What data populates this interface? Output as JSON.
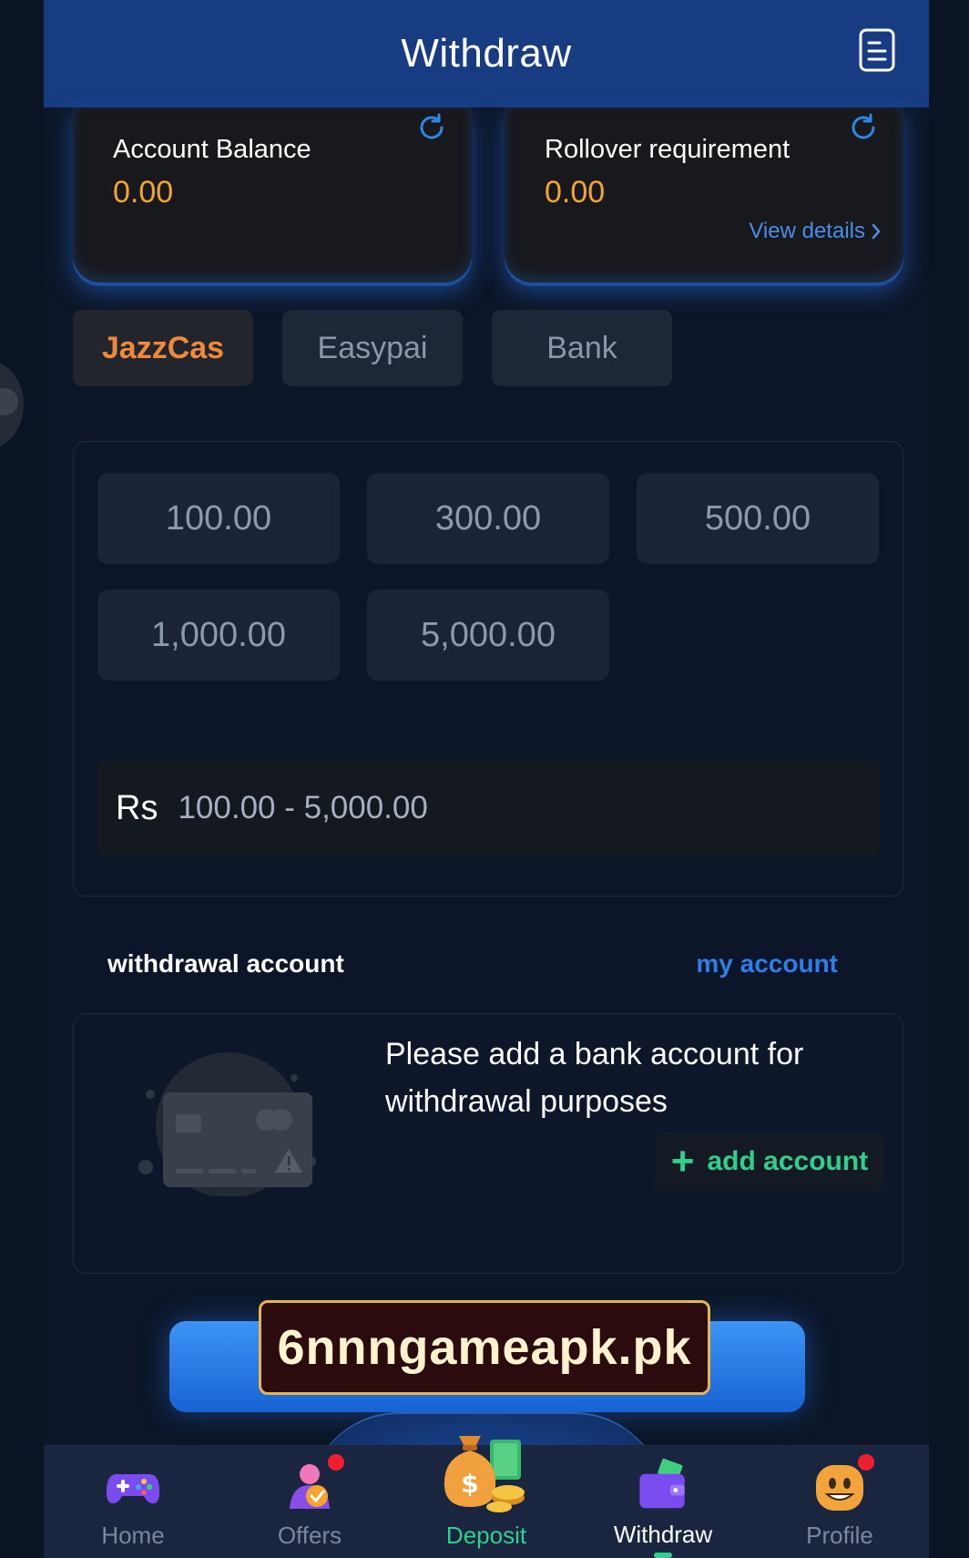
{
  "header": {
    "title": "Withdraw",
    "icon": "document-icon"
  },
  "balance_cards": [
    {
      "label": "Account Balance",
      "value": "0.00"
    },
    {
      "label": "Rollover requirement",
      "value": "0.00",
      "link": "View details"
    }
  ],
  "payment_tabs": [
    {
      "label": "JazzCas",
      "active": true
    },
    {
      "label": "Easypai",
      "active": false
    },
    {
      "label": "Bank",
      "active": false
    }
  ],
  "amounts": [
    "100.00",
    "300.00",
    "500.00",
    "1,000.00",
    "5,000.00"
  ],
  "amount_input": {
    "currency": "Rs",
    "range": "100.00 - 5,000.00"
  },
  "withdrawal_account": {
    "title": "withdrawal account",
    "my_account": "my account",
    "message": "Please add a bank account for withdrawal purposes",
    "add_button": "add account"
  },
  "watermark": "6nnngameapk.pk",
  "bottom_nav": [
    {
      "label": "Home",
      "icon": "gamepad-icon"
    },
    {
      "label": "Offers",
      "icon": "offers-icon",
      "badge": true
    },
    {
      "label": "Deposit",
      "icon": "money-bag-icon"
    },
    {
      "label": "Withdraw",
      "icon": "wallet-icon",
      "active": true
    },
    {
      "label": "Profile",
      "icon": "profile-face-icon",
      "badge": true
    }
  ],
  "colors": {
    "accent_blue": "#173c82",
    "balance_orange": "#f5a432",
    "green": "#2fd08c",
    "link_blue": "#2e7ee8"
  }
}
